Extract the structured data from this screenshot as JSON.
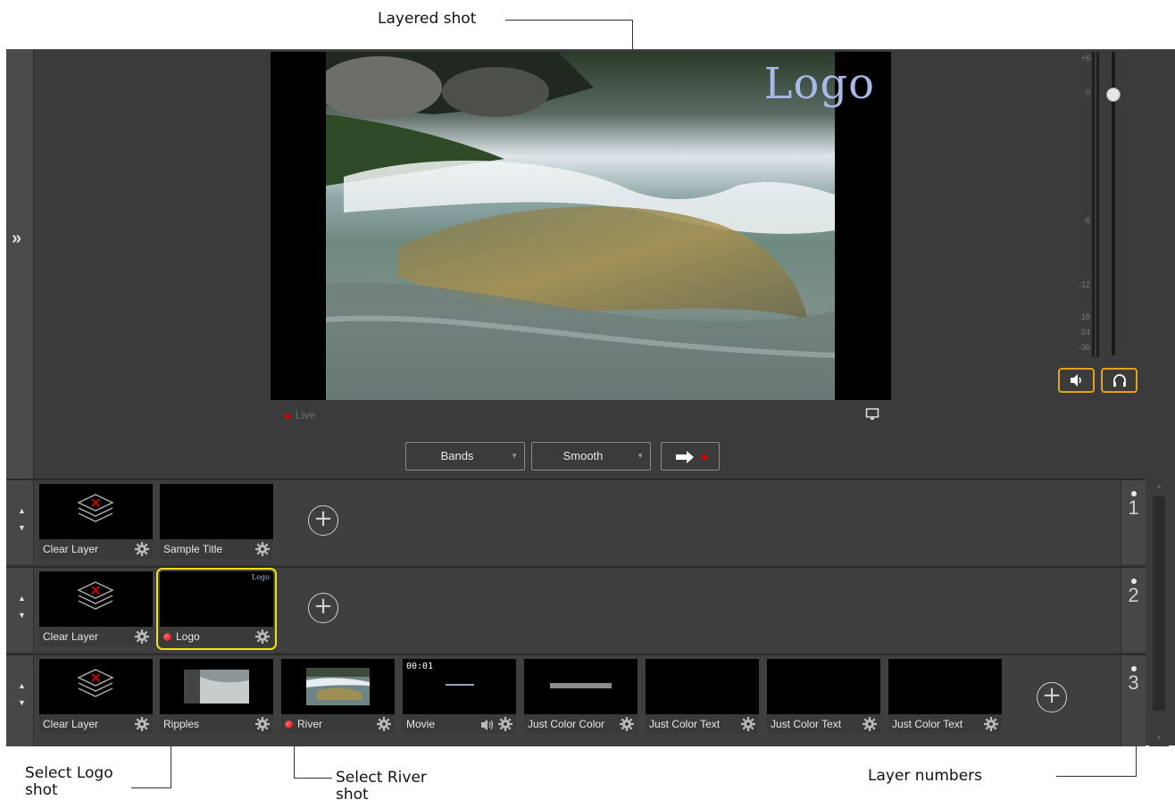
{
  "callouts": {
    "layered_shot": "Layered shot",
    "select_logo": [
      "Select Logo",
      "shot"
    ],
    "select_river": [
      "Select River",
      "shot"
    ],
    "layer_numbers": "Layer numbers"
  },
  "preview": {
    "overlay_logo": "Logo",
    "live_label": "Live"
  },
  "transition": {
    "effect": "Bands",
    "speed": "Smooth"
  },
  "audio_meter": {
    "labels": [
      "+6",
      "0",
      "-6",
      "-12",
      "-18",
      "-24",
      "-36"
    ]
  },
  "layers": [
    {
      "number": "1",
      "shots": [
        {
          "label": "Clear Layer",
          "kind": "clear"
        },
        {
          "label": "Sample Title",
          "kind": "title"
        }
      ]
    },
    {
      "number": "2",
      "shots": [
        {
          "label": "Clear Layer",
          "kind": "clear"
        },
        {
          "label": "Logo",
          "kind": "logo",
          "selected": true,
          "thumb_text": "Logo"
        }
      ]
    },
    {
      "number": "3",
      "shots": [
        {
          "label": "Clear Layer",
          "kind": "clear"
        },
        {
          "label": "Ripples",
          "kind": "video"
        },
        {
          "label": "River",
          "kind": "video",
          "live": true
        },
        {
          "label": "Movie",
          "kind": "movie",
          "timecode": "00:01"
        },
        {
          "label": "Just Color Color",
          "kind": "color"
        },
        {
          "label": "Just Color Text",
          "kind": "color"
        },
        {
          "label": "Just Color Text",
          "kind": "color"
        },
        {
          "label": "Just Color Text",
          "kind": "color"
        }
      ]
    }
  ],
  "colors": {
    "app_bg": "#3b3b3b",
    "selection": "#f0e21a",
    "live_red": "#e00000",
    "audio_button_border": "#e2a21a"
  }
}
